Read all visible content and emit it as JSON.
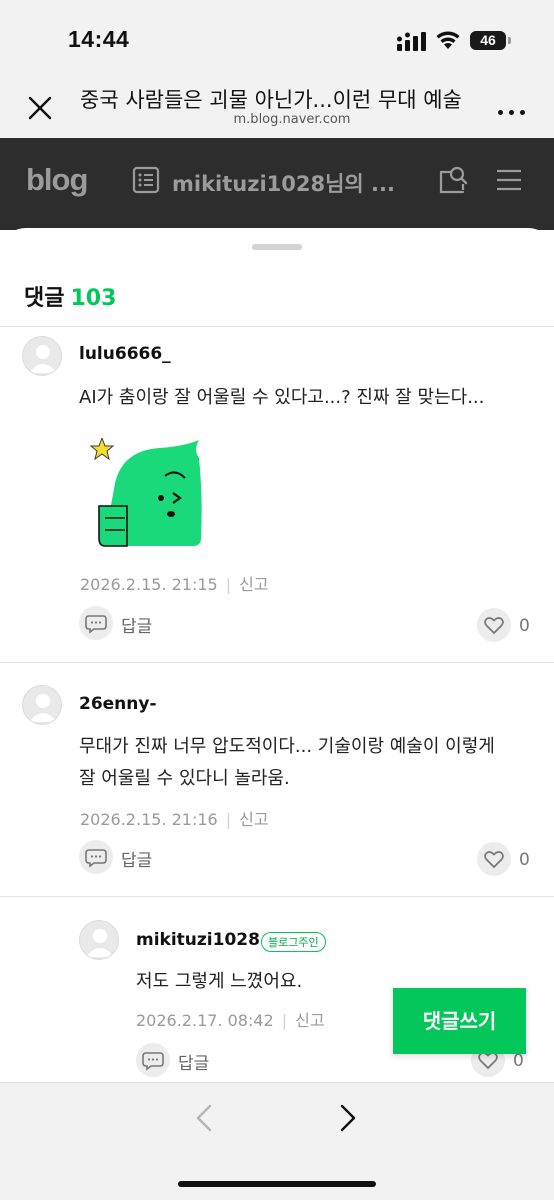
{
  "status_bar": {
    "time": "14:44",
    "battery": "46"
  },
  "browser": {
    "title": "중국 사람들은 괴물 아닌가...이런 무대 예술",
    "url": "m.blog.naver.com"
  },
  "blog_header": {
    "logo": "blog",
    "owner": "mikituzi1028님의 ..."
  },
  "comments_panel": {
    "title": "댓글",
    "count": "103",
    "comments": [
      {
        "nickname": "lulu6666_",
        "text": "AI가 춤이랑 잘 어울릴 수 있다고...? 진짜 잘 맞는다...",
        "sticker": "green-character-sticker",
        "date": "2026.2.15. 21:15",
        "report": "신고",
        "reply": "답글",
        "likes": "0"
      },
      {
        "nickname": "26enny-",
        "text_lines": [
          "무대가 진짜 너무 압도적이다... 기술이랑 예술이 이렇게",
          "잘 어울릴 수 있다니 놀라움."
        ],
        "date": "2026.2.15. 21:16",
        "report": "신고",
        "reply": "답글",
        "likes": "0"
      },
      {
        "nickname": "mikituzi1028",
        "badge": "블로그주인",
        "text": "저도 그렇게 느꼈어요.",
        "date": "2026.2.17. 08:42",
        "report": "신고",
        "reply": "답글",
        "likes": "0"
      }
    ],
    "write_button": "댓글쓰기"
  },
  "colors": {
    "accent": "#03c75a",
    "header_bg": "#2d2d2d",
    "chrome_bg": "#f2f2f2"
  }
}
